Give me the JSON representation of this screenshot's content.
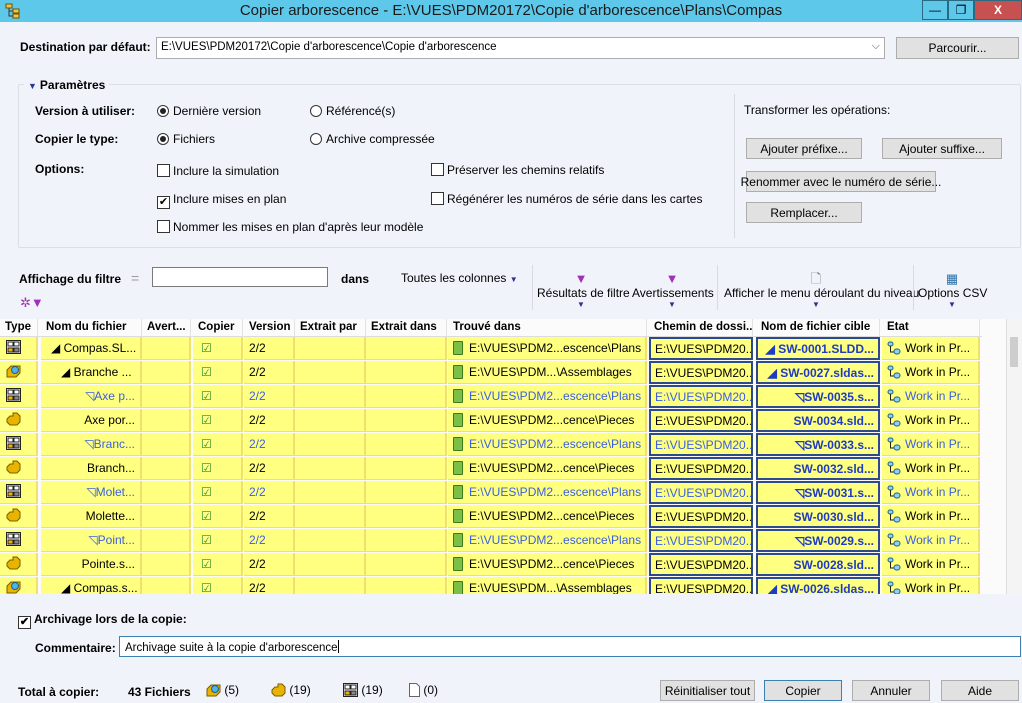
{
  "window": {
    "title": "Copier arborescence - E:\\VUES\\PDM20172\\Copie d'arborescence\\Plans\\Compas",
    "controls": {
      "minimize": "—",
      "maximize": "❐",
      "close": "X"
    }
  },
  "destination": {
    "label": "Destination par défaut:",
    "value": "E:\\VUES\\PDM20172\\Copie d'arborescence\\Copie d'arborescence",
    "browse_label": "Parcourir..."
  },
  "params": {
    "title": "Paramètres",
    "version_label": "Version à utiliser:",
    "version_options": [
      {
        "label": "Dernière version",
        "selected": true
      },
      {
        "label": "Référencé(s)",
        "selected": false
      }
    ],
    "copy_type_label": "Copier le type:",
    "copy_type_options": [
      {
        "label": "Fichiers",
        "selected": true
      },
      {
        "label": "Archive compressée",
        "selected": false
      }
    ],
    "options_label": "Options:",
    "options": [
      {
        "label": "Inclure la simulation",
        "checked": false
      },
      {
        "label": "Inclure mises en plan",
        "checked": true
      },
      {
        "label": "Nommer les mises en plan d'après leur modèle",
        "checked": false
      },
      {
        "label": "Préserver les chemins relatifs",
        "checked": false
      },
      {
        "label": "Régénérer les numéros de série dans les cartes",
        "checked": false
      }
    ],
    "transform_label": "Transformer les opérations:",
    "transform_buttons": {
      "prefix": "Ajouter préfixe...",
      "suffix": "Ajouter suffixe...",
      "rename": "Renommer avec le numéro de série...",
      "replace": "Remplacer..."
    }
  },
  "filter": {
    "label": "Affichage du filtre",
    "operator": "=",
    "value": "",
    "in_label": "dans",
    "columns_label": "Toutes les colonnes",
    "toolbar": {
      "filter_results": "Résultats de filtre",
      "warnings": "Avertissements",
      "level_menu": "Afficher le menu déroulant du niveau",
      "csv_options": "Options CSV"
    }
  },
  "grid": {
    "columns": [
      "Type",
      "Nom du fichier",
      "Avert...",
      "Copier",
      "Version",
      "Extrait par",
      "Extrait dans",
      "Trouvé dans",
      "Chemin de dossi...",
      "Nom de fichier cible",
      "Etat"
    ],
    "rows": [
      {
        "type": "drawing",
        "name": "◢ Compas.SL...",
        "copy": "☑",
        "version": "2/2",
        "found": "E:\\VUES\\PDM2...escence\\Plans",
        "path": "E:\\VUES\\PDM20...",
        "target": "◢ SW-0001.SLDD...",
        "state": "Work in Pr...",
        "ref": false
      },
      {
        "type": "assembly",
        "name": "◢ Branche ...",
        "copy": "☑",
        "version": "2/2",
        "found": "E:\\VUES\\PDM...\\Assemblages",
        "path": "E:\\VUES\\PDM20...",
        "target": "◢ SW-0027.sldas...",
        "state": "Work in Pr...",
        "ref": false
      },
      {
        "type": "drawing",
        "name": "◹Axe p...",
        "copy": "☑",
        "version": "2/2",
        "found": "E:\\VUES\\PDM2...escence\\Plans",
        "path": "E:\\VUES\\PDM20...",
        "target": "◹SW-0035.s...",
        "state": "Work in Pr...",
        "ref": true
      },
      {
        "type": "part",
        "name": "Axe por...",
        "copy": "☑",
        "version": "2/2",
        "found": "E:\\VUES\\PDM2...cence\\Pieces",
        "path": "E:\\VUES\\PDM20...",
        "target": "SW-0034.sld...",
        "state": "Work in Pr...",
        "ref": false
      },
      {
        "type": "drawing",
        "name": "◹Branc...",
        "copy": "☑",
        "version": "2/2",
        "found": "E:\\VUES\\PDM2...escence\\Plans",
        "path": "E:\\VUES\\PDM20...",
        "target": "◹SW-0033.s...",
        "state": "Work in Pr...",
        "ref": true
      },
      {
        "type": "part",
        "name": "Branch...",
        "copy": "☑",
        "version": "2/2",
        "found": "E:\\VUES\\PDM2...cence\\Pieces",
        "path": "E:\\VUES\\PDM20...",
        "target": "SW-0032.sld...",
        "state": "Work in Pr...",
        "ref": false
      },
      {
        "type": "drawing",
        "name": "◹Molet...",
        "copy": "☑",
        "version": "2/2",
        "found": "E:\\VUES\\PDM2...escence\\Plans",
        "path": "E:\\VUES\\PDM20...",
        "target": "◹SW-0031.s...",
        "state": "Work in Pr...",
        "ref": true
      },
      {
        "type": "part",
        "name": "Molette...",
        "copy": "☑",
        "version": "2/2",
        "found": "E:\\VUES\\PDM2...cence\\Pieces",
        "path": "E:\\VUES\\PDM20...",
        "target": "SW-0030.sld...",
        "state": "Work in Pr...",
        "ref": false
      },
      {
        "type": "drawing",
        "name": "◹Point...",
        "copy": "☑",
        "version": "2/2",
        "found": "E:\\VUES\\PDM2...escence\\Plans",
        "path": "E:\\VUES\\PDM20...",
        "target": "◹SW-0029.s...",
        "state": "Work in Pr...",
        "ref": true
      },
      {
        "type": "part",
        "name": "Pointe.s...",
        "copy": "☑",
        "version": "2/2",
        "found": "E:\\VUES\\PDM2...cence\\Pieces",
        "path": "E:\\VUES\\PDM20...",
        "target": "SW-0028.sld...",
        "state": "Work in Pr...",
        "ref": false
      },
      {
        "type": "assembly",
        "name": "◢ Compas.s...",
        "copy": "☑",
        "version": "2/2",
        "found": "E:\\VUES\\PDM...\\Assemblages",
        "path": "E:\\VUES\\PDM20...",
        "target": "◢ SW-0026.sldas...",
        "state": "Work in Pr...",
        "ref": false
      }
    ]
  },
  "checkin": {
    "label": "Archivage lors de la copie:",
    "checked": true,
    "comment_label": "Commentaire:",
    "comment_value": "Archivage suite à la copie d'arborescence"
  },
  "totals": {
    "label": "Total à copier:",
    "files": "43 Fichiers",
    "assemblies": "(5)",
    "parts": "(19)",
    "drawings": "(19)",
    "other": "(0)"
  },
  "footer_buttons": {
    "reset": "Réinitialiser tout",
    "copy": "Copier",
    "cancel": "Annuler",
    "help": "Aide"
  },
  "colors": {
    "titlebar": "#5ec8eb",
    "row_bg": "#ffff80",
    "ref_text": "#3b5fe0",
    "target_text": "#1d3bc4",
    "close": "#c75050"
  }
}
